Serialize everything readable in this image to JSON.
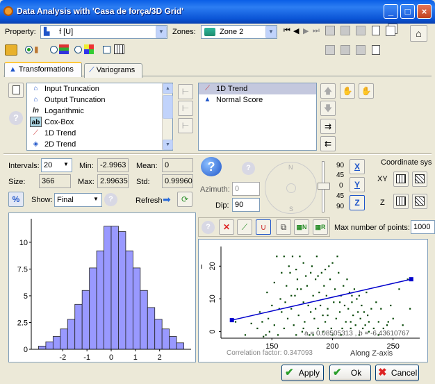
{
  "window": {
    "title": "Data Analysis with 'Casa de força/3D Grid'",
    "minimize": "_",
    "maximize": "□",
    "close": "×"
  },
  "toolbar": {
    "property_label": "Property:",
    "property_value": "f [U]",
    "zones_label": "Zones:",
    "zones_value": "Zone 2"
  },
  "tabs": [
    {
      "label": "Transformations"
    },
    {
      "label": "Variograms"
    }
  ],
  "transforms": {
    "items": [
      {
        "label": "Input Truncation"
      },
      {
        "label": "Output Truncation"
      },
      {
        "label": "Logarithmic"
      },
      {
        "label": "Cox-Box"
      },
      {
        "label": "1D Trend"
      },
      {
        "label": "2D Trend"
      }
    ],
    "applied": [
      {
        "label": "1D Trend"
      },
      {
        "label": "Normal Score"
      }
    ],
    "ln_icon": "ln",
    "ab_icon": "ab"
  },
  "stats": {
    "intervals_label": "Intervals:",
    "intervals_value": "20",
    "min_label": "Min:",
    "min_value": "-2.9963",
    "mean_label": "Mean:",
    "mean_value": "0",
    "size_label": "Size:",
    "size_value": "366",
    "max_label": "Max:",
    "max_value": "2.99635",
    "std_label": "Std:",
    "std_value": "0.99960",
    "percent_label": "%",
    "show_label": "Show:",
    "show_value": "Final",
    "refresh_label": "Refresh"
  },
  "orientation": {
    "azimuth_label": "Azimuth:",
    "azimuth_value": "0",
    "dip_label": "Dip:",
    "dip_value": "90",
    "compass_n": "N",
    "compass_s": "S",
    "dip_ticks": [
      "90",
      "45",
      "0",
      "45",
      "90"
    ],
    "coordinate_label": "Coordinate sys",
    "xy_label": "XY",
    "z_label": "Z",
    "x_axis_btn": "X",
    "y_axis_btn": "Y",
    "z_axis_btn": "Z"
  },
  "trend": {
    "max_points_label": "Max number of points:",
    "max_points_value": "1000",
    "equation": "a = 0.08505313 ,  b = -6.43610767",
    "correlation": "Correlation factor: 0.347093",
    "xaxis_label": "Along Z-axis"
  },
  "buttons": {
    "apply": "Apply",
    "ok": "Ok",
    "cancel": "Cancel"
  },
  "chart_data": [
    {
      "type": "bar",
      "x": [
        -2.85,
        -2.55,
        -2.25,
        -1.95,
        -1.65,
        -1.35,
        -1.05,
        -0.75,
        -0.45,
        -0.15,
        0.15,
        0.45,
        0.75,
        1.05,
        1.35,
        1.65,
        1.95,
        2.25,
        2.55,
        2.85
      ],
      "values": [
        0.3,
        0.7,
        1.2,
        1.9,
        2.8,
        4.2,
        5.5,
        7.6,
        9.2,
        11.5,
        11.5,
        11.0,
        9.2,
        7.6,
        5.5,
        3.9,
        2.8,
        1.9,
        1.2,
        0.6
      ],
      "xticks": [
        -2,
        -1,
        0,
        1,
        2
      ],
      "yticks": [
        0,
        2.5,
        5,
        7.5,
        10
      ],
      "ytick_labels": [
        "0",
        "2.5",
        "5",
        "7.5",
        "10"
      ],
      "xlim": [
        -3.3,
        3.3
      ],
      "ylim": [
        0,
        12.2
      ],
      "bar_color": "#9999FF"
    },
    {
      "type": "scatter",
      "xticks": [
        150,
        200,
        250
      ],
      "yticks": [
        0,
        10,
        20
      ],
      "xlim": [
        108,
        272
      ],
      "ylim": [
        -2,
        26
      ],
      "trend_line": [
        [
          117,
          3.5
        ],
        [
          265,
          16
        ]
      ],
      "trend_color": "#0000CC",
      "point_color": "#004400",
      "points": [
        [
          120,
          3
        ],
        [
          128,
          -1
        ],
        [
          133,
          2.5
        ],
        [
          138,
          1
        ],
        [
          140,
          6
        ],
        [
          143,
          -1.5
        ],
        [
          145,
          -1
        ],
        [
          147,
          4
        ],
        [
          150,
          8
        ],
        [
          152,
          2
        ],
        [
          154,
          23
        ],
        [
          155,
          -1
        ],
        [
          157,
          10
        ],
        [
          158,
          6
        ],
        [
          160,
          1
        ],
        [
          160,
          23
        ],
        [
          162,
          14
        ],
        [
          163,
          4
        ],
        [
          165,
          18
        ],
        [
          166,
          7
        ],
        [
          167,
          23
        ],
        [
          168,
          2
        ],
        [
          169,
          11
        ],
        [
          170,
          -1
        ],
        [
          171,
          16
        ],
        [
          172,
          5
        ],
        [
          173,
          23
        ],
        [
          174,
          13
        ],
        [
          175,
          0
        ],
        [
          176,
          9
        ],
        [
          177,
          3
        ],
        [
          178,
          17
        ],
        [
          179,
          14
        ],
        [
          180,
          8
        ],
        [
          181,
          -1
        ],
        [
          182,
          6
        ],
        [
          183,
          20
        ],
        [
          184,
          11
        ],
        [
          185,
          4
        ],
        [
          186,
          16
        ],
        [
          187,
          23
        ],
        [
          188,
          1
        ],
        [
          189,
          12
        ],
        [
          190,
          8
        ],
        [
          191,
          18
        ],
        [
          192,
          5
        ],
        [
          193,
          14
        ],
        [
          194,
          3
        ],
        [
          195,
          11
        ],
        [
          196,
          7
        ],
        [
          197,
          20
        ],
        [
          198,
          16
        ],
        [
          200,
          -1
        ],
        [
          201,
          9
        ],
        [
          202,
          13
        ],
        [
          203,
          4
        ],
        [
          204,
          23
        ],
        [
          205,
          18
        ],
        [
          206,
          6
        ],
        [
          207,
          11
        ],
        [
          208,
          1
        ],
        [
          209,
          14
        ],
        [
          210,
          8
        ],
        [
          211,
          3
        ],
        [
          212,
          16
        ],
        [
          213,
          7
        ],
        [
          214,
          12
        ],
        [
          215,
          1
        ],
        [
          216,
          9
        ],
        [
          217,
          5
        ],
        [
          218,
          13
        ],
        [
          219,
          2
        ],
        [
          220,
          10
        ],
        [
          221,
          6
        ],
        [
          222,
          11
        ],
        [
          223,
          4
        ],
        [
          224,
          8
        ],
        [
          225,
          1
        ],
        [
          226,
          6
        ],
        [
          227,
          2
        ],
        [
          228,
          12
        ],
        [
          229,
          5
        ],
        [
          230,
          3
        ],
        [
          232,
          7
        ],
        [
          234,
          1
        ],
        [
          236,
          9
        ],
        [
          238,
          3
        ],
        [
          240,
          7
        ],
        [
          242,
          1
        ],
        [
          245,
          2
        ],
        [
          248,
          8
        ],
        [
          250,
          4
        ],
        [
          255,
          13
        ],
        [
          258,
          2
        ],
        [
          262,
          16
        ],
        [
          264,
          7
        ],
        [
          146,
          12
        ],
        [
          152,
          15
        ],
        [
          158,
          18
        ],
        [
          164,
          20
        ],
        [
          170,
          19
        ],
        [
          176,
          21
        ],
        [
          182,
          18
        ],
        [
          188,
          17
        ],
        [
          194,
          19
        ],
        [
          200,
          21
        ],
        [
          176,
          1
        ],
        [
          184,
          -1
        ],
        [
          192,
          0
        ],
        [
          199,
          1
        ],
        [
          207,
          -1
        ],
        [
          215,
          3
        ],
        [
          222,
          -1
        ],
        [
          230,
          0
        ],
        [
          238,
          -1
        ],
        [
          246,
          3
        ],
        [
          148,
          0
        ],
        [
          142,
          3
        ],
        [
          156,
          7
        ],
        [
          161,
          9
        ],
        [
          166,
          11
        ],
        [
          171,
          13
        ],
        [
          186,
          7
        ],
        [
          196,
          5
        ],
        [
          206,
          9
        ],
        [
          216,
          11
        ]
      ]
    }
  ]
}
